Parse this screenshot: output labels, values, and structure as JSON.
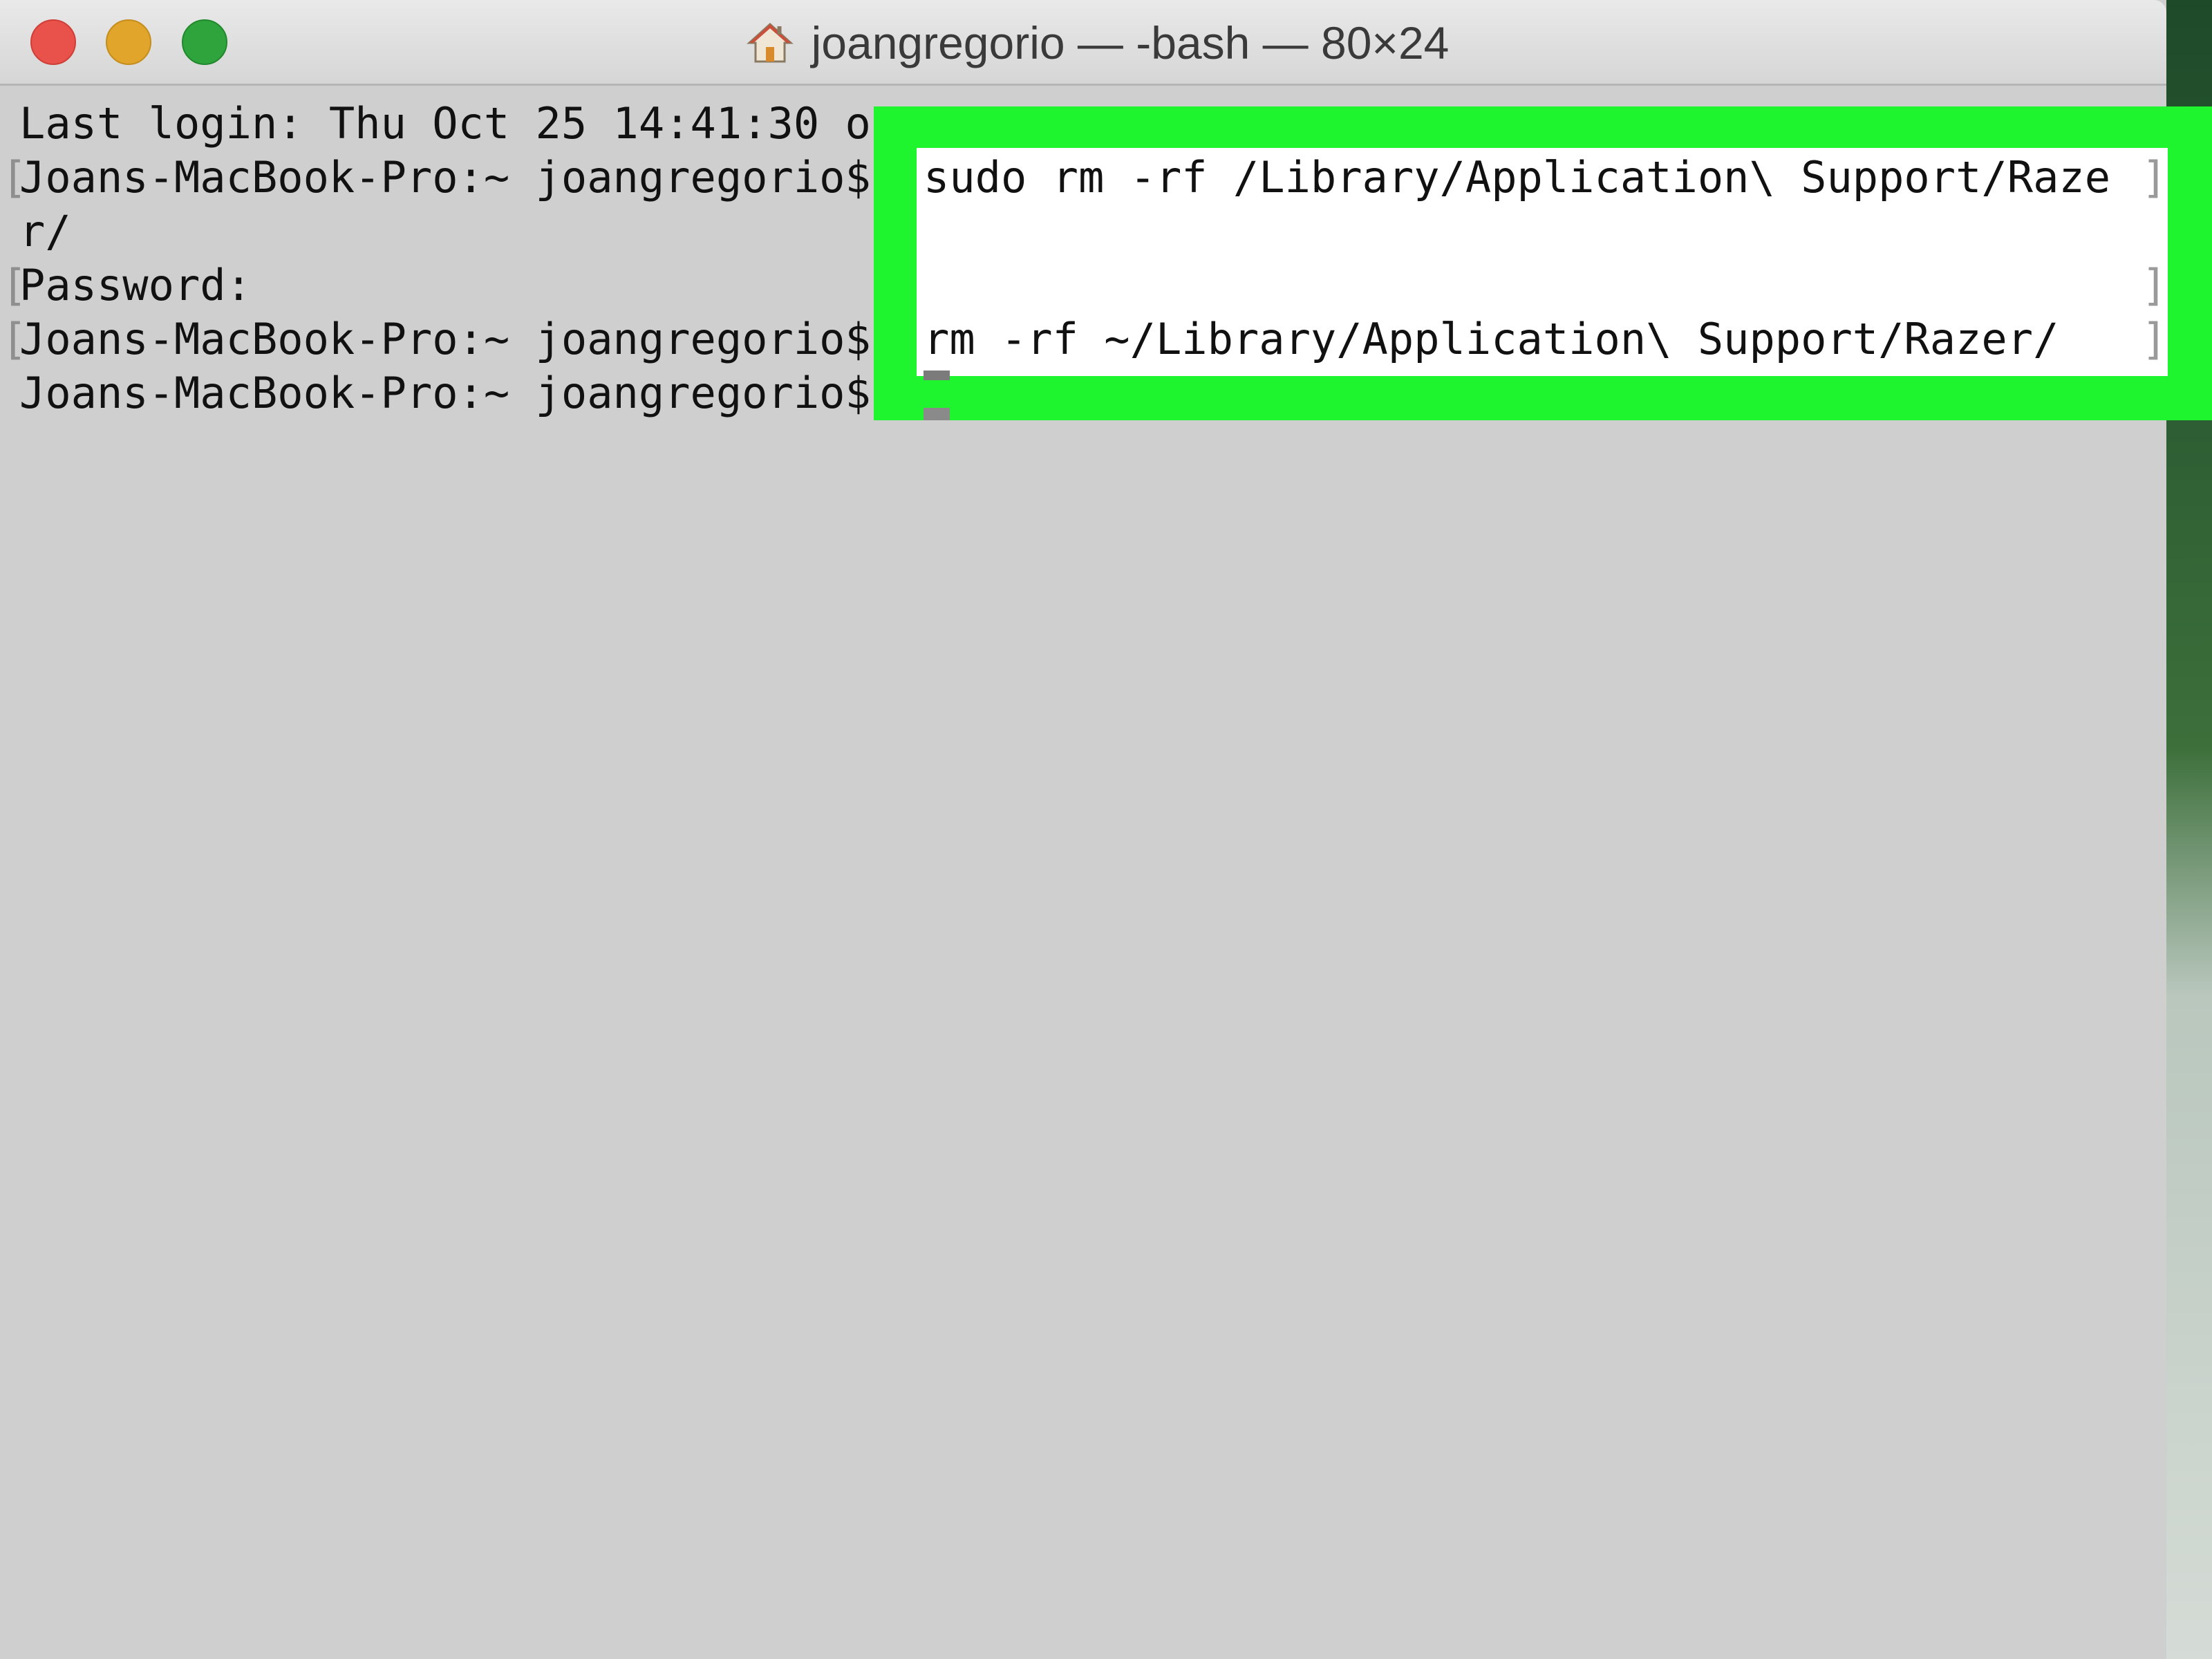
{
  "window": {
    "title": "joangregorio — -bash — 80×24"
  },
  "terminal": {
    "lines": [
      "Last login: Thu Oct 25 14:41:30 o",
      "Joans-MacBook-Pro:~ joangregorio$",
      "r/",
      "Password:",
      "Joans-MacBook-Pro:~ joangregorio$",
      "Joans-MacBook-Pro:~ joangregorio$"
    ]
  },
  "highlight": {
    "color": "#1ff52f",
    "command1": "sudo rm -rf /Library/Application\\ Support/Raze",
    "command2": "rm -rf ~/Library/Application\\ Support/Razer/"
  },
  "icons": {
    "close": "close-traffic-light",
    "minimize": "minimize-traffic-light",
    "zoom": "zoom-traffic-light",
    "home": "home-icon"
  }
}
